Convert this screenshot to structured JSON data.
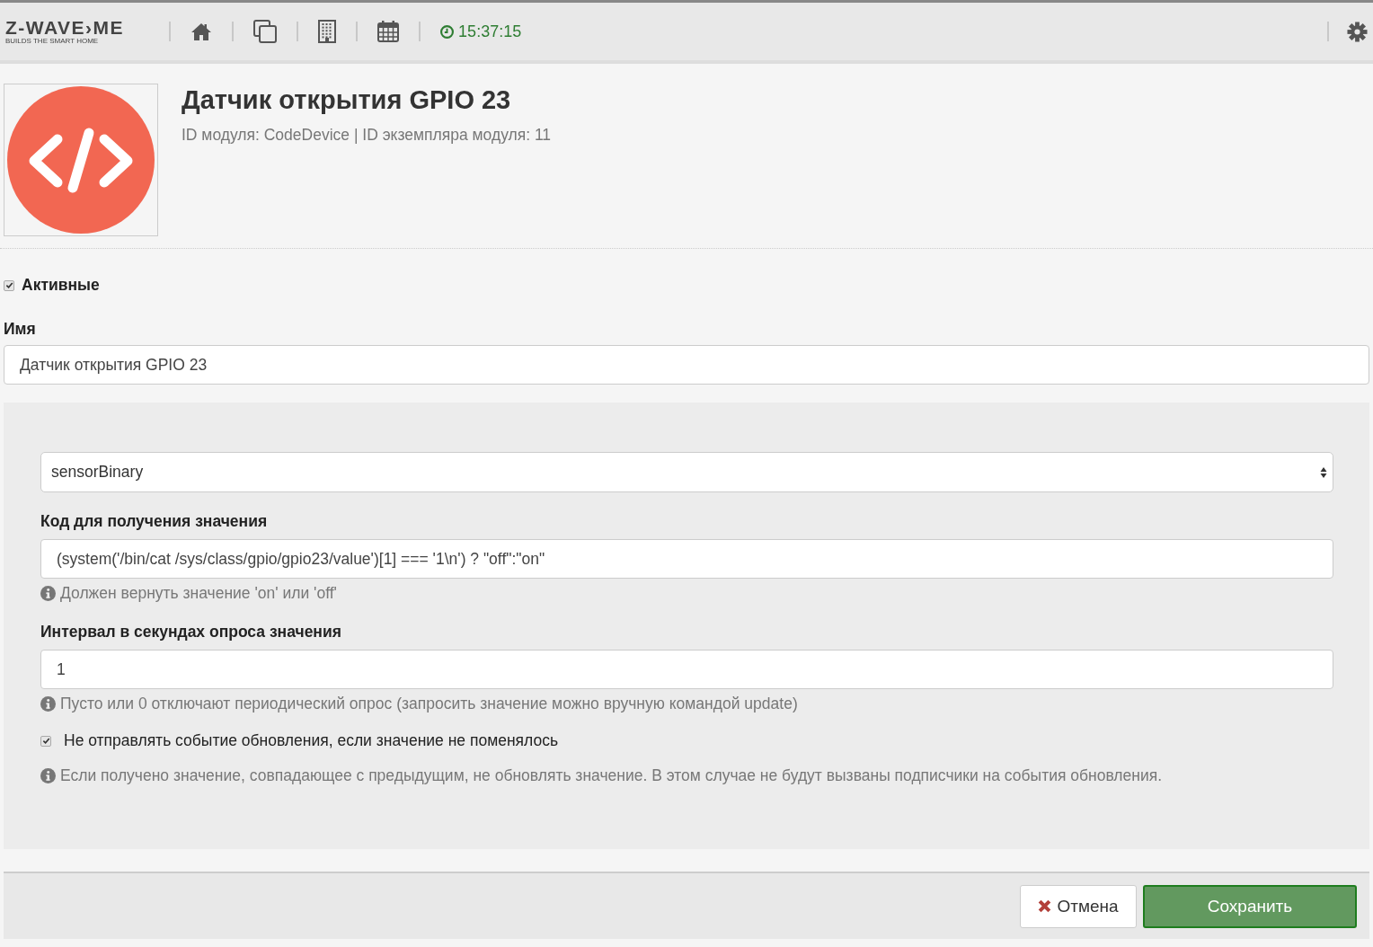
{
  "topbar": {
    "logo": {
      "wordmark": "Z-WAVE›ME",
      "tagline": "BUILDS THE SMART HOME"
    },
    "clock": "15:37:15"
  },
  "header": {
    "title": "Датчик открытия GPIO 23",
    "subtitle": "ID модуля: CodeDevice | ID экземпляра модуля: 11"
  },
  "active": {
    "label": "Активные",
    "checked": true
  },
  "name": {
    "label": "Имя",
    "value": "Датчик открытия GPIO 23"
  },
  "settings": {
    "select": {
      "value": "sensorBinary"
    },
    "fields": [
      {
        "kind": "text",
        "label": "Код для получения значения",
        "value": "(system('/bin/cat /sys/class/gpio/gpio23/value')[1] === '1\\n') ? \"off\":\"on\"",
        "help": "Должен вернуть значение 'on' или 'off'"
      },
      {
        "kind": "text",
        "label": "Интервал в секундах опроса значения",
        "value": "1",
        "help": "Пусто или 0 отключают периодический опрос (запросить значение можно вручную командой update)"
      },
      {
        "kind": "checkbox",
        "label": "Не отправлять событие обновления, если значение не поменялось",
        "checked": true,
        "help": "Если получено значение, совпадающее с предыдущим, не обновлять значение. В этом случае не будут вызваны подписчики на события обновления."
      }
    ]
  },
  "footer": {
    "buttons": [
      {
        "kind": "cancel",
        "label": "Отмена"
      },
      {
        "kind": "primary",
        "label": "Сохранить"
      }
    ]
  }
}
